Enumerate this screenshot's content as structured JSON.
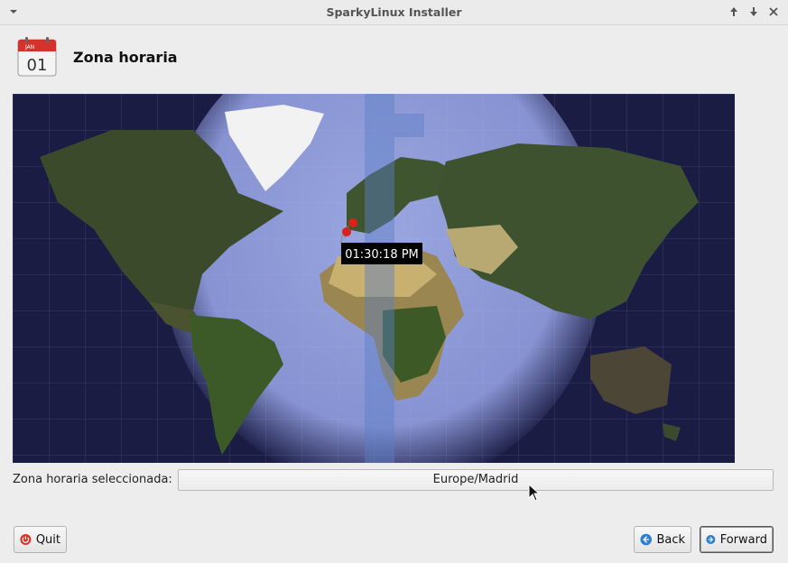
{
  "window": {
    "title": "SparkyLinux Installer"
  },
  "header": {
    "title": "Zona horaria",
    "calendar_month": "JAN",
    "calendar_day": "01"
  },
  "map": {
    "tooltip_time": "01:30:18 PM"
  },
  "timezone": {
    "label": "Zona horaria seleccionada:",
    "value": "Europe/Madrid"
  },
  "buttons": {
    "quit": "Quit",
    "back": "Back",
    "forward": "Forward"
  },
  "icons": {
    "window_menu": "chevron-down-icon",
    "maximize": "arrow-up-icon",
    "close": "close-icon",
    "quit": "power-icon",
    "back": "arrow-left-circle-icon",
    "forward": "arrow-right-circle-icon"
  },
  "colors": {
    "window_bg": "#ededed",
    "night": "#1a1c44",
    "day_ocean": "#8e9bd8",
    "button_icon_blue": "#2d7fd1",
    "quit_icon_red": "#d9362b"
  }
}
